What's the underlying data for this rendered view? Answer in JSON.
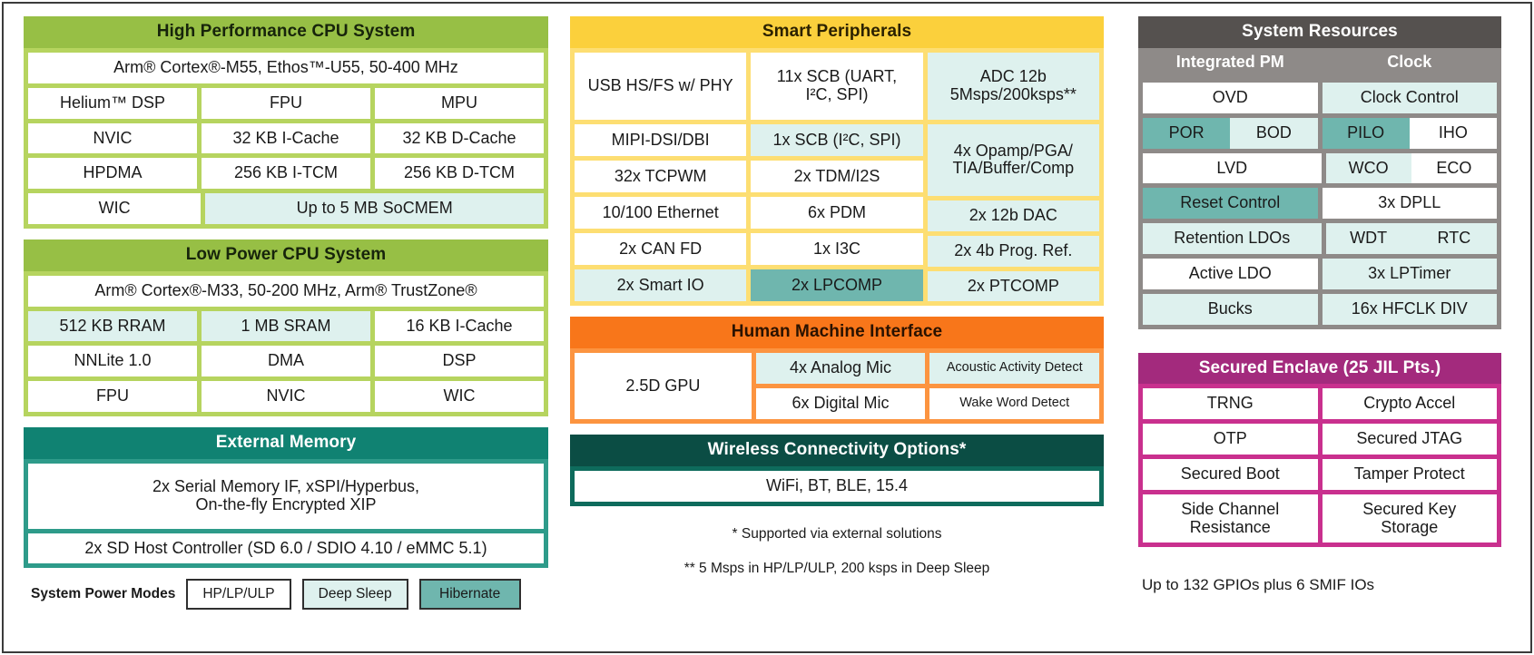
{
  "colors": {
    "green_header": "#97BF45",
    "green_body": "#B6D45F",
    "teal_header": "#108272",
    "teal_body": "#2E9B8A",
    "yellow_header": "#FBD03C",
    "yellow_body": "#FDDE72",
    "orange_header": "#F8761A",
    "orange_body": "#FC9440",
    "dark_teal_header": "#0B4D44",
    "dark_teal_body": "#0E6B5C",
    "gray_header": "#55514F",
    "gray_body": "#8E8A88",
    "magenta_header": "#A32A7D",
    "magenta_body": "#C9308E",
    "mint_cell": "#DEF1EE",
    "teal_cell": "#6FB6AE",
    "white_cell": "#FFFFFF"
  },
  "hp_cpu": {
    "title": "High Performance CPU System",
    "core": "Arm® Cortex®-M55, Ethos™-U55, 50-400 MHz",
    "r1": [
      "Helium™ DSP",
      "FPU",
      "MPU"
    ],
    "r2": [
      "NVIC",
      "32 KB I-Cache",
      "32 KB D-Cache"
    ],
    "r3": [
      "HPDMA",
      "256 KB I-TCM",
      "256 KB D-TCM"
    ],
    "r4a": "WIC",
    "r4b": "Up to 5 MB SoCMEM"
  },
  "lp_cpu": {
    "title": "Low Power CPU System",
    "core": "Arm® Cortex®-M33, 50-200 MHz, Arm® TrustZone®",
    "r1": [
      "512 KB RRAM",
      "1 MB SRAM",
      "16 KB I-Cache"
    ],
    "r2": [
      "NNLite 1.0",
      "DMA",
      "DSP"
    ],
    "r3": [
      "FPU",
      "NVIC",
      "WIC"
    ]
  },
  "ext_mem": {
    "title": "External Memory",
    "line1": "2x Serial Memory IF, xSPI/Hyperbus,",
    "line2": "On-the-fly Encrypted XIP",
    "sd": "2x SD Host Controller (SD 6.0 / SDIO 4.10 / eMMC 5.1)"
  },
  "power_modes": {
    "label": "System Power Modes",
    "chips": [
      "HP/LP/ULP",
      "Deep Sleep",
      "Hibernate"
    ]
  },
  "smart_peripherals": {
    "title": "Smart Peripherals",
    "c1": [
      "USB HS/FS w/ PHY",
      "MIPI-DSI/DBI",
      "32x TCPWM",
      "10/100 Ethernet",
      "2x CAN FD",
      "2x Smart IO"
    ],
    "c2_1a": "11x SCB (UART,",
    "c2_1b": "I²C, SPI)",
    "c2_rest": [
      "1x SCB (I²C, SPI)",
      "2x TDM/I2S",
      "6x PDM",
      "1x I3C",
      "2x LPCOMP"
    ],
    "c3_1a": "ADC 12b",
    "c3_1b": "5Msps/200ksps**",
    "c3_2a": "4x Opamp/PGA/",
    "c3_2b": "TIA/Buffer/Comp",
    "c3_rest": [
      "2x 12b DAC",
      "2x 4b Prog. Ref.",
      "2x PTCOMP"
    ]
  },
  "hmi": {
    "title": "Human Machine Interface",
    "gpu": "2.5D GPU",
    "mic1": "4x Analog Mic",
    "mic2": "6x Digital Mic",
    "det1": "Acoustic Activity Detect",
    "det2": "Wake Word Detect"
  },
  "wireless": {
    "title": "Wireless Connectivity Options*",
    "value": "WiFi, BT, BLE, 15.4"
  },
  "footnotes": {
    "star": "* Supported via external solutions",
    "doublestar": "** 5 Msps in HP/LP/ULP, 200 ksps in Deep Sleep"
  },
  "system_resources": {
    "title": "System Resources",
    "sub_pm": "Integrated PM",
    "sub_clock": "Clock",
    "pm": [
      "OVD",
      "POR",
      "BOD",
      "LVD",
      "Reset Control",
      "Retention LDOs",
      "Active LDO",
      "Bucks"
    ],
    "clock": [
      "Clock Control",
      "PILO",
      "IHO",
      "WCO",
      "ECO",
      "3x DPLL",
      "WDT",
      "RTC",
      "3x LPTimer",
      "16x HFCLK DIV"
    ]
  },
  "secured_enclave": {
    "title": "Secured Enclave (25 JIL Pts.)",
    "rows": [
      [
        "TRNG",
        "Crypto Accel"
      ],
      [
        "OTP",
        "Secured JTAG"
      ],
      [
        "Secured Boot",
        "Tamper Protect"
      ],
      [
        "Side Channel\nResistance",
        "Secured Key\nStorage"
      ]
    ],
    "r4_left1": "Side Channel",
    "r4_left2": "Resistance",
    "r4_right1": "Secured Key",
    "r4_right2": "Storage"
  },
  "gpio_note": "Up to 132 GPIOs plus 6 SMIF IOs"
}
